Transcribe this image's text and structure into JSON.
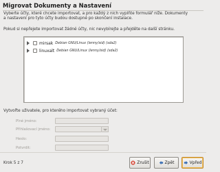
{
  "window": {
    "title": "Migrovat Dokumenty a Nastavení"
  },
  "intro": {
    "line1": "Vyberte účty, které chcete importovat, a pro každý z nich vyplňte formulář níže. Dokumenty",
    "line2": "a nastavení pro tyto účty budou dostupné po skončení instalace."
  },
  "skip_hint": "Pokud si nepřejete importovat žádné účty, nic nevybírejte a přejděte na další stránku.",
  "accounts": [
    {
      "name": "mirsak",
      "os": "Debian GNU/Linux (lenny/sid) (sda2)",
      "checked": false
    },
    {
      "name": "linuxalt",
      "os": "Debian GNU/Linux (lenny/sid) (sda2)",
      "checked": false
    }
  ],
  "assign": {
    "label": "Vytvořte uživatele, pro kterého importovat vybraný účet:",
    "fields": {
      "full_name": "Plné jméno:",
      "login": "Přihlašovací jméno:",
      "password": "Heslo:",
      "confirm": "Potvrdit:"
    }
  },
  "footer": {
    "step": "Krok 5 z 7",
    "cancel": "Zrušit",
    "back": "Zpět",
    "next": "Vpřed"
  },
  "colors": {
    "background": "#edeceb",
    "accent": "#e0a12c"
  }
}
